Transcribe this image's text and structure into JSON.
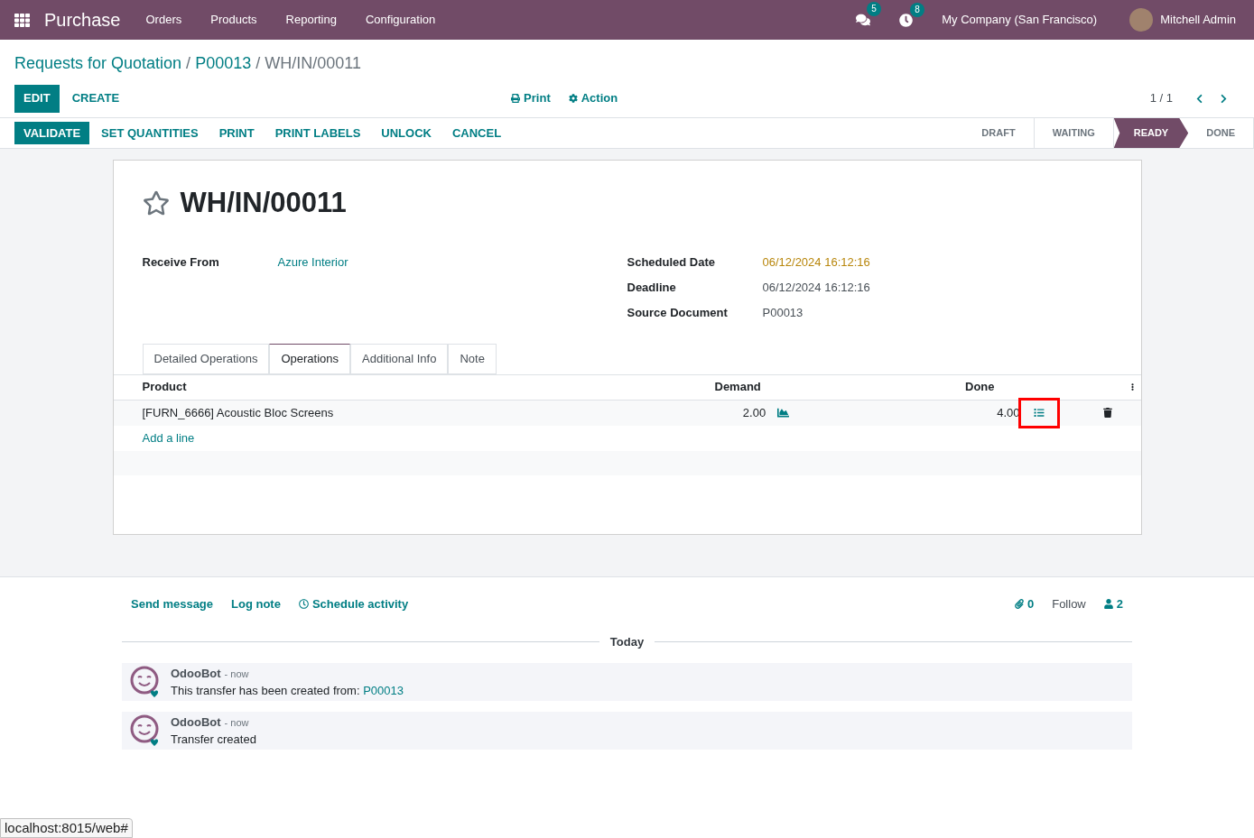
{
  "navbar": {
    "app_name": "Purchase",
    "menu": [
      "Orders",
      "Products",
      "Reporting",
      "Configuration"
    ],
    "messages_count": "5",
    "activities_count": "8",
    "company": "My Company (San Francisco)",
    "user": "Mitchell Admin"
  },
  "breadcrumb": [
    {
      "label": "Requests for Quotation",
      "kind": "link"
    },
    {
      "label": "/",
      "kind": "separator"
    },
    {
      "label": "P00013",
      "kind": "link"
    },
    {
      "label": "/",
      "kind": "separator"
    },
    {
      "label": "WH/IN/00011",
      "kind": "current"
    }
  ],
  "control_buttons": [
    {
      "label": "EDIT",
      "kind": "primary"
    },
    {
      "label": "CREATE",
      "kind": "secondary"
    }
  ],
  "sidebar_buttons": [
    "Print",
    "Action"
  ],
  "pager": "1 / 1",
  "action_buttons": [
    {
      "label": "VALIDATE",
      "kind": "primary"
    },
    {
      "label": "SET QUANTITIES",
      "kind": "secondary"
    },
    {
      "label": "PRINT",
      "kind": "secondary"
    },
    {
      "label": "PRINT LABELS",
      "kind": "secondary"
    },
    {
      "label": "UNLOCK",
      "kind": "secondary"
    },
    {
      "label": "CANCEL",
      "kind": "secondary"
    }
  ],
  "statusbar": [
    {
      "label": "DRAFT",
      "selected": false
    },
    {
      "label": "WAITING",
      "selected": false
    },
    {
      "label": "READY",
      "selected": true
    },
    {
      "label": "DONE",
      "selected": false
    }
  ],
  "record": {
    "title": "WH/IN/00011",
    "starred": false,
    "left_fields": [
      {
        "label": "Receive From",
        "value": "Azure Interior",
        "kind": "link"
      }
    ],
    "right_fields": [
      {
        "label": "Scheduled Date",
        "value": "06/12/2024 16:12:16",
        "kind": "warning"
      },
      {
        "label": "Deadline",
        "value": "06/12/2024 16:12:16",
        "kind": "plain"
      },
      {
        "label": "Source Document",
        "value": "P00013",
        "kind": "plain"
      }
    ]
  },
  "tabs": [
    {
      "label": "Detailed Operations",
      "selected": false
    },
    {
      "label": "Operations",
      "selected": true
    },
    {
      "label": "Additional Info",
      "selected": false
    },
    {
      "label": "Note",
      "selected": false
    }
  ],
  "table": {
    "columns": [
      "Product",
      "Demand",
      "Done"
    ],
    "rows": [
      {
        "product": "[FURN_6666] Acoustic Bloc Screens",
        "demand": "2.00",
        "done": "4.00",
        "detail_highlighted": true
      }
    ],
    "add_line": "Add a line"
  },
  "chatter": {
    "actions": [
      "Send message",
      "Log note",
      "Schedule activity"
    ],
    "attachments": "0",
    "follow": "Follow",
    "followers": "2",
    "date_separator": "Today",
    "messages": [
      {
        "author": "OdooBot",
        "time": "- now",
        "body": "This transfer has been created from: ",
        "link": "P00013"
      },
      {
        "author": "OdooBot",
        "time": "- now",
        "body": "Transfer created"
      }
    ]
  },
  "browser_status": "localhost:8015/web#"
}
